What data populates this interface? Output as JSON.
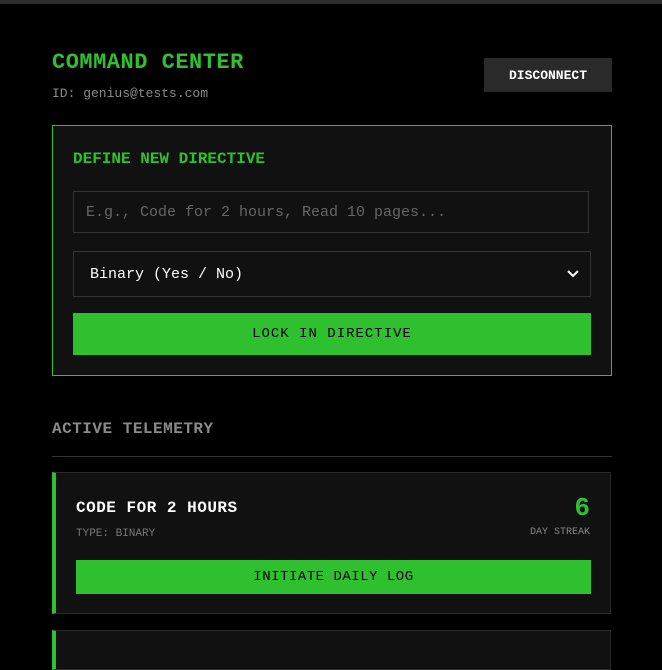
{
  "header": {
    "title": "COMMAND CENTER",
    "user_id": "ID: genius@tests.com",
    "disconnect_label": "DISCONNECT"
  },
  "directive_form": {
    "title": "DEFINE NEW DIRECTIVE",
    "input_placeholder": "E.g., Code for 2 hours, Read 10 pages...",
    "input_value": "",
    "type_selected": "Binary (Yes / No)",
    "submit_label": "LOCK IN DIRECTIVE"
  },
  "telemetry": {
    "title": "ACTIVE TELEMETRY",
    "directives": [
      {
        "name": "CODE FOR 2 HOURS",
        "type": "TYPE: BINARY",
        "streak": "6",
        "streak_label": "DAY STREAK",
        "action_label": "INITIATE DAILY LOG"
      }
    ]
  },
  "colors": {
    "accent": "#2ec02e",
    "background": "#000000",
    "panel": "#111111",
    "muted_text": "#8a8a8a"
  },
  "icons": {
    "select_chevron": "chevron-down-icon"
  }
}
